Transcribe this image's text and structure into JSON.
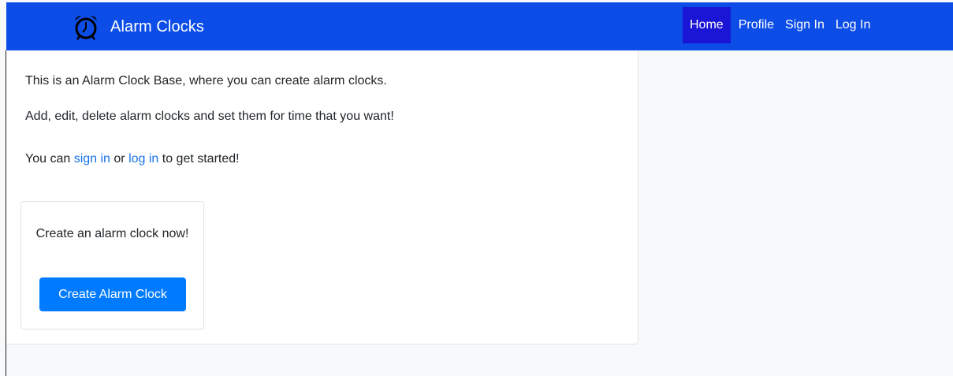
{
  "navbar": {
    "brand_icon": "alarm-clock-icon",
    "brand": "Alarm Clocks",
    "bg_color": "#0d4de7",
    "active_color": "#1b15d6",
    "links": [
      {
        "label": "Home",
        "active": true
      },
      {
        "label": "Profile",
        "active": false
      },
      {
        "label": "Sign In",
        "active": false
      },
      {
        "label": "Log In",
        "active": false
      }
    ]
  },
  "intro": {
    "line1": "This is an Alarm Clock Base, where you can create alarm clocks.",
    "line2": "Add, edit, delete alarm clocks and set them for time that you want!",
    "line3_prefix": "You can ",
    "sign_in_link": "sign in",
    "line3_middle": " or ",
    "log_in_link": "log in",
    "line3_suffix": " to get started!",
    "link_color": "#1a73e8"
  },
  "cta": {
    "text": "Create an alarm clock now!",
    "button_label": "Create Alarm Clock",
    "button_color": "#007bff"
  }
}
